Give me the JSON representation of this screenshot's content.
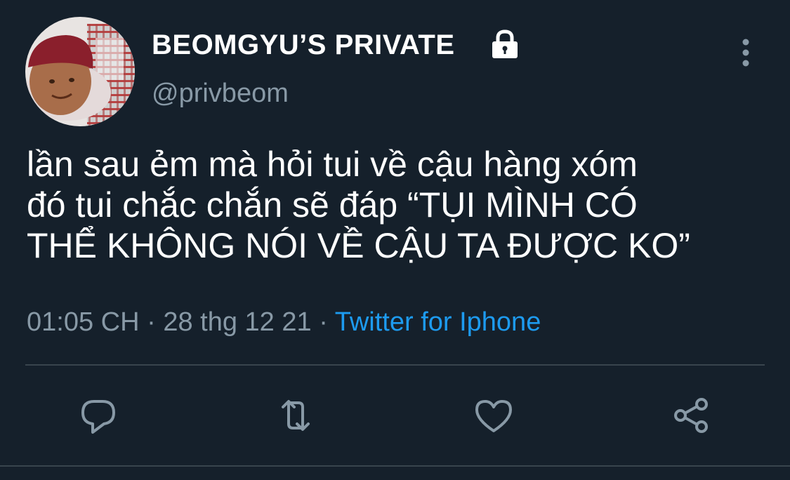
{
  "author": {
    "display_name": "BEOMGYU’S PRIVATE",
    "username": "@privbeom",
    "avatar_icon": "avatar-photo",
    "protected_icon": "lock-icon"
  },
  "tweet": {
    "text": "lần sau ẻm mà hỏi tui về cậu hàng xóm\nđó tui chắc chắn sẽ đáp “TỤI MÌNH CÓ\nTHỂ KHÔNG NÓI VỀ CẬU TA ĐƯỢC KO”",
    "time": "01:05 CH",
    "separator": " · ",
    "date": "28 thg 12 21",
    "source_separator": " · ",
    "source": "Twitter for Iphone"
  },
  "actions": {
    "reply_icon": "reply-icon",
    "retweet_icon": "retweet-icon",
    "like_icon": "heart-icon",
    "share_icon": "share-icon",
    "more_icon": "more-vertical-icon"
  },
  "colors": {
    "background": "#15202b",
    "primary_text": "#ffffff",
    "secondary_text": "#8899a6",
    "link": "#1d9bf0",
    "divider": "#38444d"
  }
}
